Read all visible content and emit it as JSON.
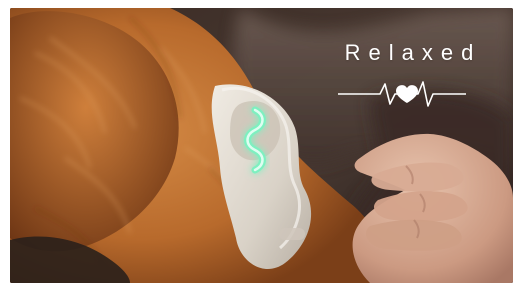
{
  "scene": {
    "overlay_text": "Relaxed",
    "icon": "heartbeat-heart-icon",
    "colors": {
      "fur": "#b86a2c",
      "harness": "#d9d2c7",
      "glow": "#7ef0c0",
      "overlay": "#ffffff",
      "background": "#2b221d"
    }
  }
}
